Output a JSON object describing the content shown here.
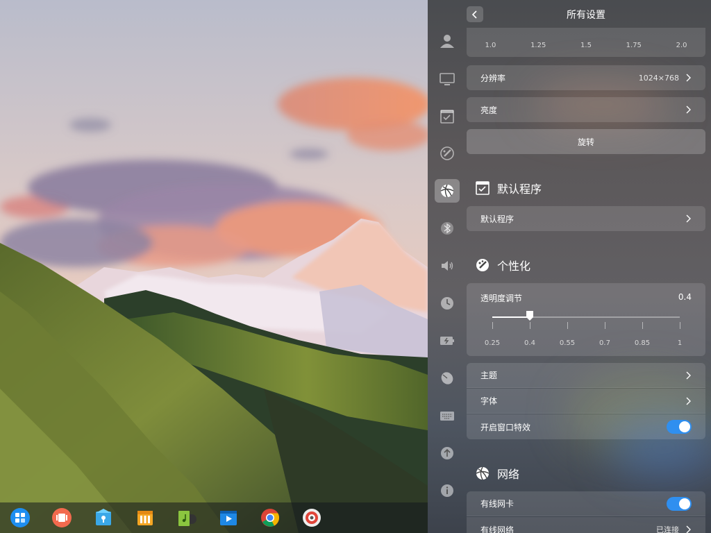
{
  "panel": {
    "title": "所有设置"
  },
  "display": {
    "scale_options": [
      "1.0",
      "1.25",
      "1.5",
      "1.75",
      "2.0"
    ],
    "resolution_label": "分辨率",
    "resolution_value": "1024×768",
    "brightness_label": "亮度",
    "rotate_label": "旋转"
  },
  "default_apps": {
    "section_title": "默认程序",
    "row_label": "默认程序"
  },
  "personalization": {
    "section_title": "个性化",
    "opacity_label": "透明度调节",
    "opacity_value": "0.4",
    "opacity_ticks": [
      "0.25",
      "0.4",
      "0.55",
      "0.7",
      "0.85",
      "1"
    ],
    "opacity_fraction": 0.2,
    "theme_label": "主题",
    "font_label": "字体",
    "window_effect_label": "开启窗口特效",
    "window_effect_on": true
  },
  "network": {
    "section_title": "网络",
    "wired_card_label": "有线网卡",
    "wired_card_on": true,
    "wired_network_label": "有线网络",
    "wired_network_status": "已连接"
  },
  "sidebar_icons": [
    "account-icon",
    "display-icon",
    "default-apps-icon",
    "personalization-icon",
    "network-icon",
    "bluetooth-icon",
    "sound-icon",
    "time-icon",
    "power-icon",
    "mouse-icon",
    "keyboard-icon",
    "update-icon",
    "info-icon"
  ],
  "dock_icons": [
    "launcher-icon",
    "multitask-icon",
    "app-store-icon",
    "file-manager-icon",
    "music-icon",
    "video-icon",
    "chrome-icon",
    "settings-icon"
  ],
  "colors": {
    "accent": "#2f8ff0",
    "panel_bg": "#4a4a4e"
  }
}
